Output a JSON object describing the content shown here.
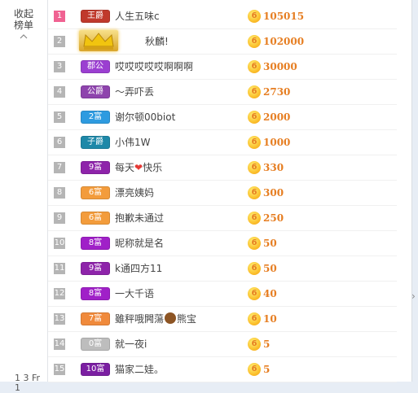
{
  "sidebar": {
    "collapse_label_1": "收起",
    "collapse_label_2": "榜单",
    "footer_text": "1 3 Fr 1"
  },
  "ranking": [
    {
      "rank": "1",
      "badge": "王爵",
      "badge_color": "#c0392b",
      "name": "人生五味c",
      "value": "105015"
    },
    {
      "rank": "2",
      "badge": "",
      "badge_color": "#e6b422",
      "crown": true,
      "name": "秋麟!",
      "value": "102000"
    },
    {
      "rank": "3",
      "badge": "郡公",
      "badge_color": "#9b3fd1",
      "name": "哎哎哎哎哎啊啊啊",
      "value": "30000"
    },
    {
      "rank": "4",
      "badge": "公爵",
      "badge_color": "#8e44ad",
      "name": "～弄吓丢",
      "value": "2730"
    },
    {
      "rank": "5",
      "badge": "2富",
      "badge_color": "#2e9be0",
      "name": "谢尔顿00biot",
      "value": "2000"
    },
    {
      "rank": "6",
      "badge": "子爵",
      "badge_color": "#1e88a8",
      "name": "小伟1W",
      "value": "1000"
    },
    {
      "rank": "7",
      "badge": "9富",
      "badge_color": "#8e24aa",
      "name": "每天",
      "name_suffix": "快乐",
      "heart": true,
      "value": "330"
    },
    {
      "rank": "8",
      "badge": "6富",
      "badge_color": "#f39c3c",
      "name": "漂亮姨妈",
      "value": "300"
    },
    {
      "rank": "9",
      "badge": "6富",
      "badge_color": "#f39c3c",
      "name": "抱歉未通过",
      "value": "250"
    },
    {
      "rank": "10",
      "badge": "8富",
      "badge_color": "#a020c8",
      "name": "昵称就是名",
      "value": "50"
    },
    {
      "rank": "11",
      "badge": "9富",
      "badge_color": "#8e24aa",
      "name": "k通四方11",
      "value": "50"
    },
    {
      "rank": "12",
      "badge": "8富",
      "badge_color": "#a020c8",
      "name": "一大千语",
      "value": "40"
    },
    {
      "rank": "13",
      "badge": "7富",
      "badge_color": "#f08a3c",
      "name": "雖秤哦闁蕩",
      "name_suffix": "熊宝",
      "bear": true,
      "value": "10"
    },
    {
      "rank": "14",
      "badge": "0富",
      "badge_color": "#bdbdbd",
      "name": "就一夜i",
      "value": "5"
    },
    {
      "rank": "15",
      "badge": "10富",
      "badge_color": "#7b1fa2",
      "name": "猫家二娃。",
      "value": "5"
    }
  ],
  "coin_glyph": "6",
  "icons": {
    "collapse": "chevron-up-icon",
    "coin": "coin-icon",
    "scroll": "chevron-right-icon"
  }
}
